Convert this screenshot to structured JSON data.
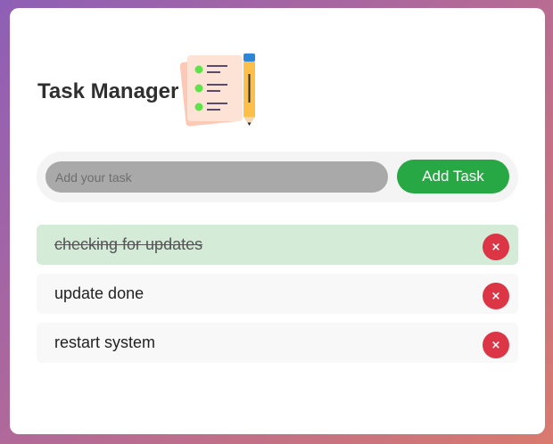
{
  "app": {
    "title": "Task Manager"
  },
  "input": {
    "placeholder": "Add your task",
    "value": ""
  },
  "add_button": {
    "label": "Add Task"
  },
  "tasks": [
    {
      "text": "checking for updates",
      "completed": true
    },
    {
      "text": "update done",
      "completed": false
    },
    {
      "text": "restart system",
      "completed": false
    }
  ],
  "delete_icon": "×",
  "icons": {
    "logo": "checklist-with-pencil-icon",
    "delete": "close-icon"
  },
  "colors": {
    "accent": "#28a745",
    "danger": "#dc3545",
    "completed_bg": "#d4ebd8"
  }
}
